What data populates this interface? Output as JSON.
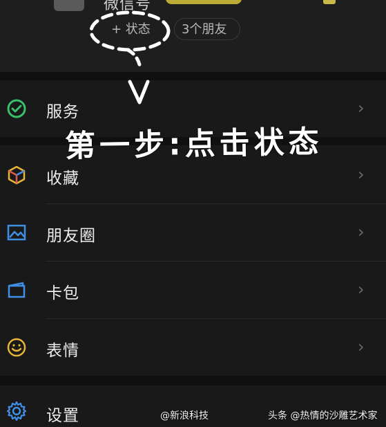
{
  "profile": {
    "nickname": "微信号",
    "status_label": "+ 状态",
    "friends_label": "3个朋友"
  },
  "menu": [
    {
      "label": "服务",
      "icon": "service-icon",
      "color": "#39c06a"
    },
    {
      "label": "收藏",
      "icon": "favorites-cube-icon",
      "color": "#e8b43a"
    },
    {
      "label": "朋友圈",
      "icon": "moments-picture-icon",
      "color": "#3f8fe6"
    },
    {
      "label": "卡包",
      "icon": "card-wallet-icon",
      "color": "#3f8fe6"
    },
    {
      "label": "表情",
      "icon": "sticker-smile-icon",
      "color": "#e8b43a"
    },
    {
      "label": "设置",
      "icon": "settings-gear-icon",
      "color": "#3f8fe6"
    }
  ],
  "annotation": {
    "text": "第一步:点击状态"
  },
  "watermarks": {
    "weibo": "@新浪科技",
    "toutiao": "头条 @热情的沙雕艺术家"
  },
  "colors": {
    "background": "#1a1a1a",
    "accent_green": "#39c06a",
    "accent_yellow": "#e8b43a",
    "accent_blue": "#3f8fe6"
  }
}
